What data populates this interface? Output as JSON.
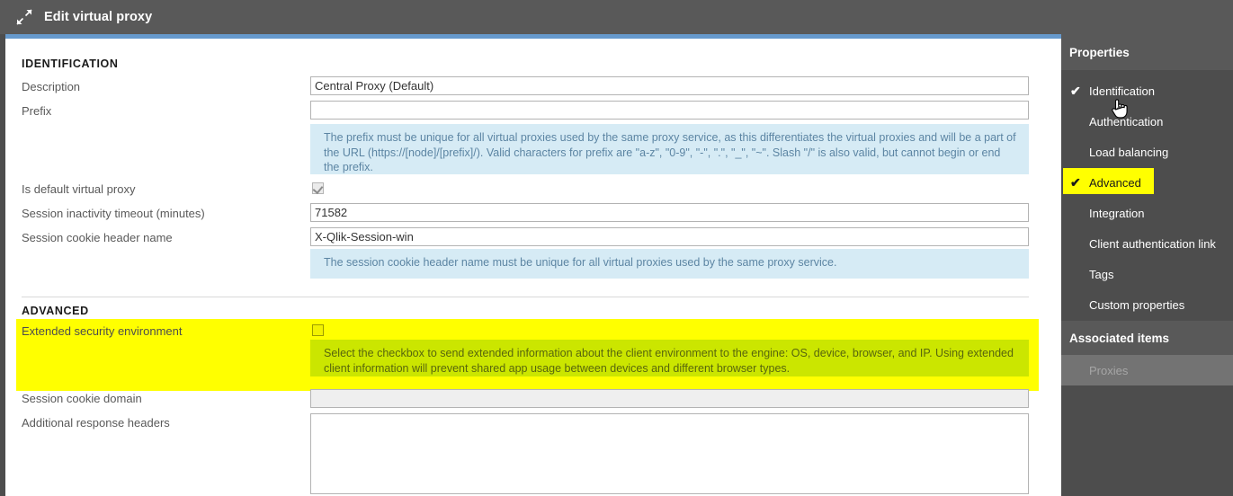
{
  "window": {
    "title": "Edit virtual proxy",
    "icon": "collapse-arrows-icon"
  },
  "colors": {
    "header_bg": "#595959",
    "accent_bar": "#6699CC",
    "info_bg": "#D6EBF5",
    "info_text": "#5C85A3",
    "highlight_yellow": "#FFFF00",
    "highlight_info": "#CBE600",
    "sidebar_bg": "#4D4D4D"
  },
  "form": {
    "identification": {
      "section_label": "IDENTIFICATION",
      "fields": {
        "description_label": "Description",
        "description_value": "Central Proxy (Default)",
        "prefix_label": "Prefix",
        "prefix_value": "",
        "prefix_help": "The prefix must be unique for all virtual proxies used by the same proxy service, as this differentiates the virtual proxies and will be a part of the URL (https://[node]/[prefix]/). Valid characters for prefix are \"a-z\", \"0-9\", \"-\", \".\", \"_\", \"~\". Slash \"/\" is also valid, but cannot begin or end the prefix.",
        "is_default_label": "Is default virtual proxy",
        "is_default_checked": true,
        "session_timeout_label": "Session inactivity timeout (minutes)",
        "session_timeout_value": "71582",
        "session_cookie_header_label": "Session cookie header name",
        "session_cookie_header_value": "X-Qlik-Session-win",
        "session_cookie_help": "The session cookie header name must be unique for all virtual proxies used by the same proxy service."
      }
    },
    "advanced": {
      "section_label": "ADVANCED",
      "fields": {
        "extended_security_label": "Extended security environment",
        "extended_security_checked": false,
        "extended_security_help": "Select the checkbox to send extended information about the client environment to the engine: OS, device, browser, and IP. Using extended client information will prevent shared app usage between devices and different browser types.",
        "session_cookie_domain_label": "Session cookie domain",
        "session_cookie_domain_value": "",
        "additional_response_headers_label": "Additional response headers",
        "additional_response_headers_value": ""
      }
    }
  },
  "sidebar": {
    "properties_header": "Properties",
    "items": [
      {
        "label": "Identification",
        "checked": true,
        "highlighted": false
      },
      {
        "label": "Authentication",
        "checked": false,
        "highlighted": false
      },
      {
        "label": "Load balancing",
        "checked": false,
        "highlighted": false
      },
      {
        "label": "Advanced",
        "checked": true,
        "highlighted": true
      },
      {
        "label": "Integration",
        "checked": false,
        "highlighted": false
      },
      {
        "label": "Client authentication link",
        "checked": false,
        "highlighted": false
      },
      {
        "label": "Tags",
        "checked": false,
        "highlighted": false
      },
      {
        "label": "Custom properties",
        "checked": false,
        "highlighted": false
      }
    ],
    "associated_header": "Associated items",
    "associated_items": [
      {
        "label": "Proxies"
      }
    ],
    "check_glyph": "✔"
  }
}
